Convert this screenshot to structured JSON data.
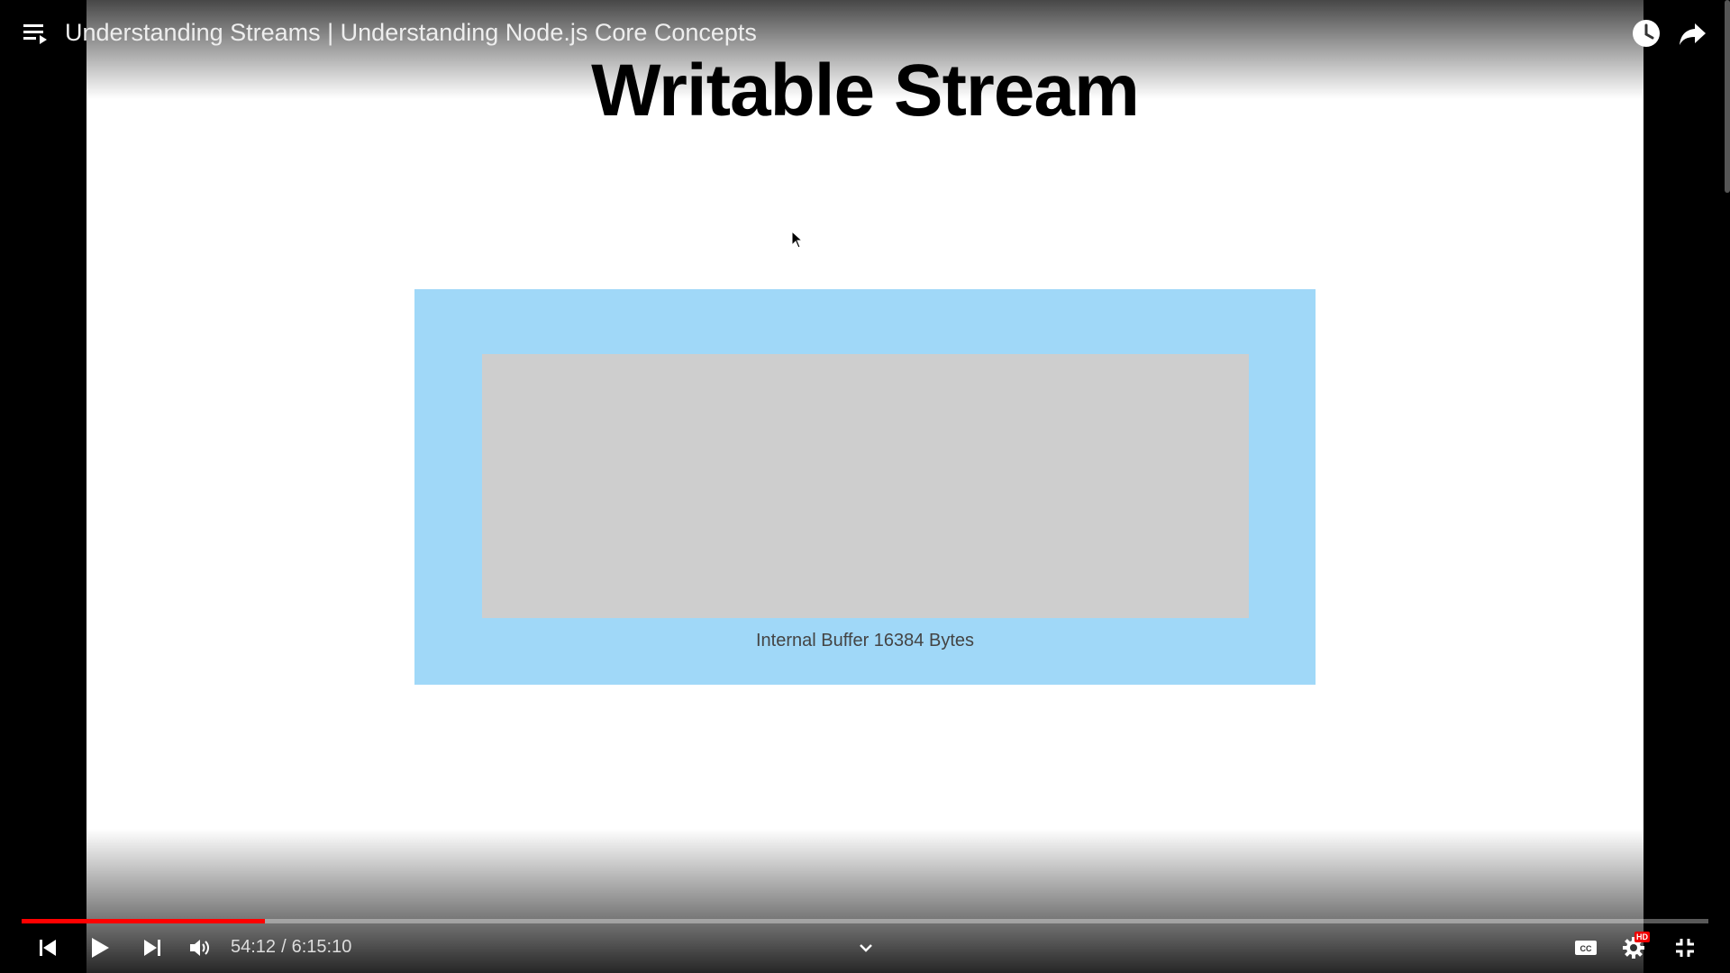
{
  "player": {
    "title": "Understanding Streams | Understanding Node.js Core Concepts",
    "current_time": "54:12",
    "separator": "/",
    "duration": "6:15:10",
    "progress_fraction": 0.1444,
    "buffered_fraction": 0.1444,
    "quality_badge": "HD",
    "accent_color": "#ff0000"
  },
  "slide": {
    "title": "Writable Stream",
    "buffer_label": "Internal Buffer 16384 Bytes",
    "outer_color": "#a0d8f8",
    "inner_color": "#cecece"
  },
  "icons": {
    "playlist": "playlist-icon",
    "watch_later": "clock-icon",
    "share": "share-icon",
    "previous": "skip-previous-icon",
    "play": "play-icon",
    "next": "skip-next-icon",
    "volume": "volume-icon",
    "chevron": "chevron-down-icon",
    "captions": "closed-captions-icon",
    "settings": "gear-icon",
    "exit_fullscreen": "exit-fullscreen-icon"
  }
}
